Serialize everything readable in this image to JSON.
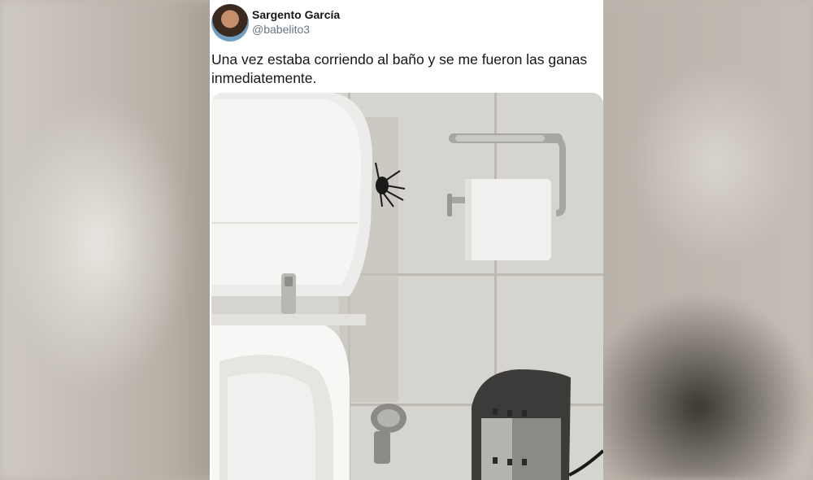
{
  "tweet": {
    "display_name": "Sargento García",
    "handle": "@babelito3",
    "text": "Una vez estaba corriendo al baño y se me fueron las ganas inmediatemente."
  },
  "icons": {
    "avatar": "user-avatar-photo"
  },
  "colors": {
    "text_primary": "#14171a",
    "text_secondary": "#657786",
    "card_background": "#ffffff"
  }
}
